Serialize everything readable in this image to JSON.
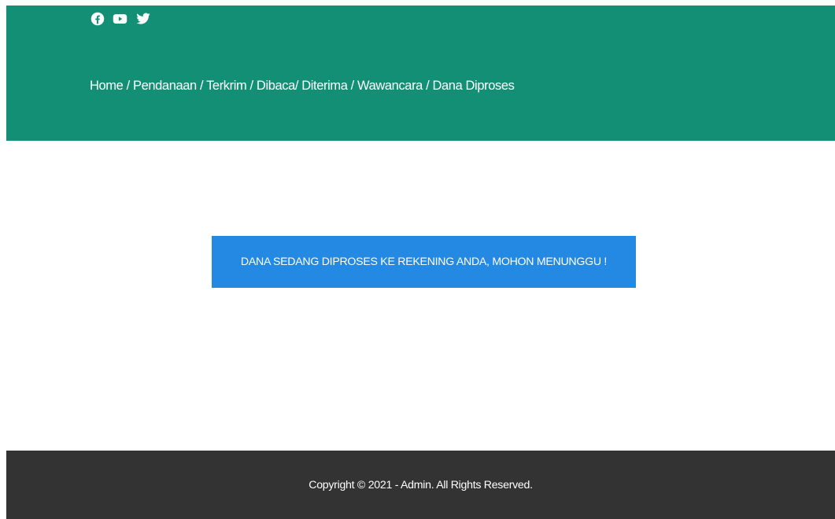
{
  "header": {
    "social_icons": [
      "facebook-icon",
      "youtube-icon",
      "twitter-icon"
    ],
    "breadcrumb": {
      "items": [
        "Home",
        "Pendanaan",
        "Terkrim",
        "Dibaca/ Diterima",
        "Wawancara",
        "Dana Diproses"
      ],
      "text": "Home / Pendanaan / Terkrim / Dibaca/ Diterima / Wawancara / Dana Diproses"
    }
  },
  "main": {
    "notice": "DANA SEDANG DIPROSES KE REKENING ANDA, MOHON MENUNGGU !"
  },
  "footer": {
    "copyright": "Copyright © 2021 - Admin. All Rights Reserved."
  },
  "colors": {
    "header_bg": "#138f76",
    "notice_bg": "#2489e2",
    "footer_bg": "#333333",
    "text": "#ffffff"
  }
}
